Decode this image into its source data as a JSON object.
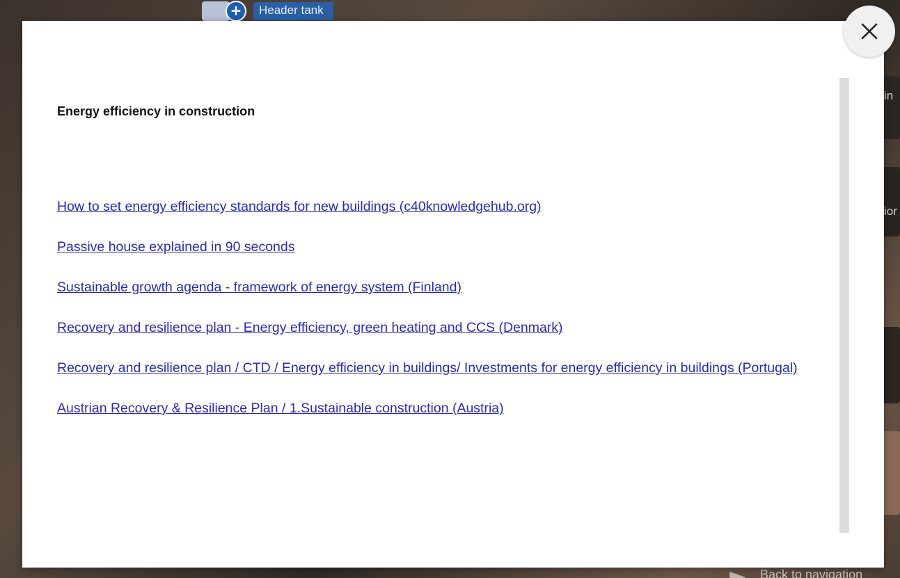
{
  "background": {
    "hotspot_label": "Header tank",
    "hotspot_plus": "+",
    "right_text_1": "in",
    "right_text_2": "ior",
    "back_navigation": "Back to navigation"
  },
  "modal": {
    "title": "Energy efficiency in construction",
    "links": [
      {
        "label": "How to set energy efficiency standards for new buildings (c40knowledgehub.org)"
      },
      {
        "label": "Passive house explained in 90 seconds"
      },
      {
        "label": "Sustainable growth agenda - framework of energy system (Finland)"
      },
      {
        "label": "Recovery and resilience plan - Energy efficiency, green heating and CCS (Denmark)"
      },
      {
        "label": "Recovery and resilience plan / CTD / Energy efficiency in buildings/ Investments for energy efficiency in buildings (Portugal)"
      },
      {
        "label": "Austrian Recovery & Resilience Plan / 1.Sustainable construction (Austria)"
      }
    ],
    "close_icon": "close-icon"
  },
  "colors": {
    "link": "#2a2ab8",
    "modal_background": "#ffffff",
    "close_button_background": "#f0f0f0",
    "hotspot_blue": "#1f5fb0"
  }
}
